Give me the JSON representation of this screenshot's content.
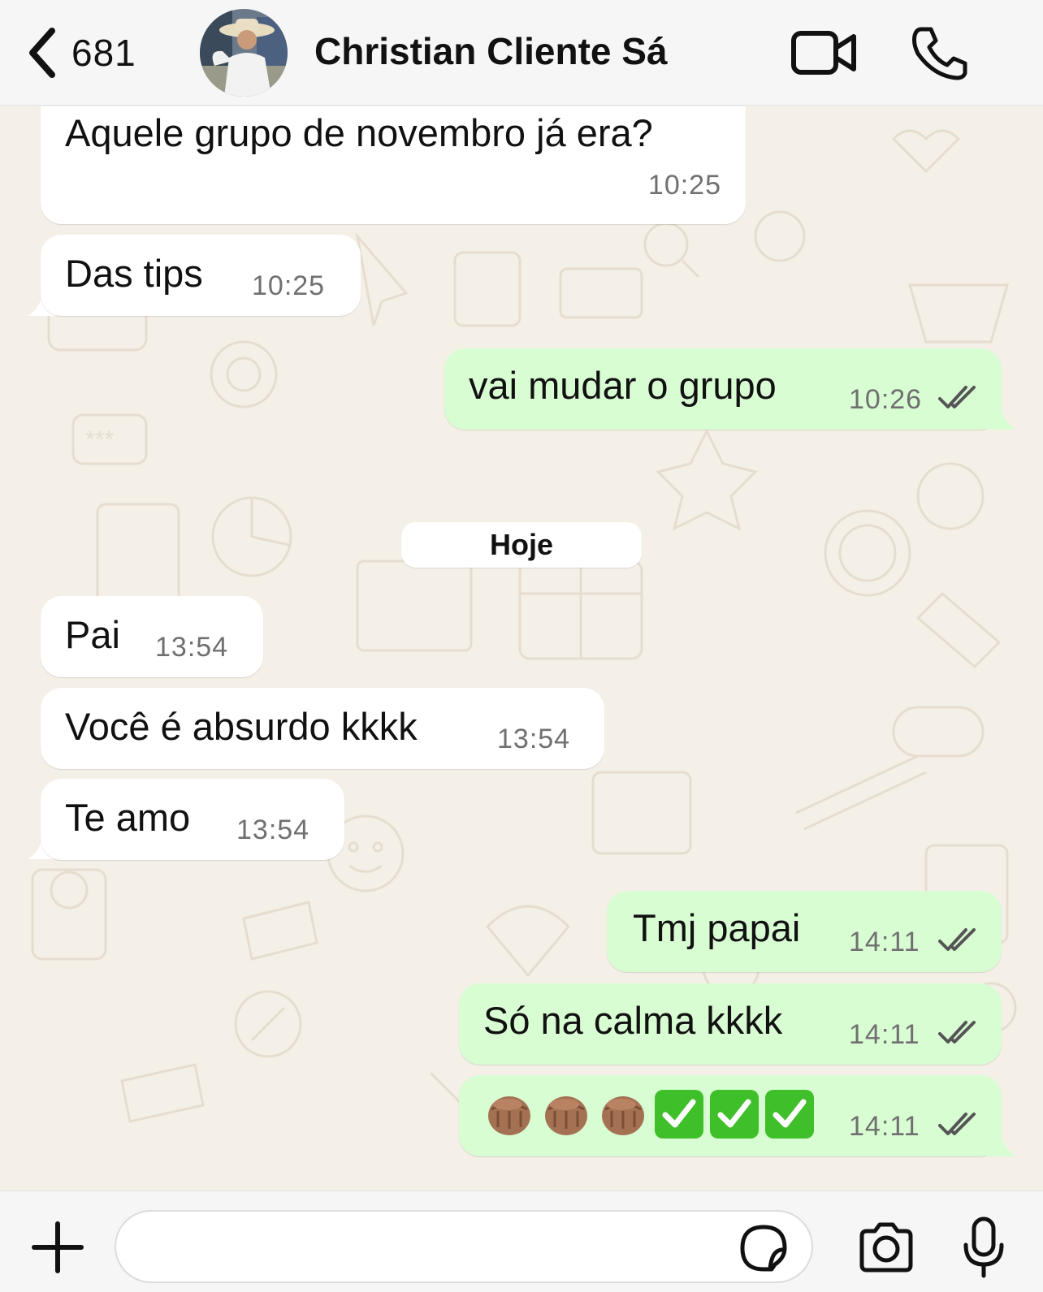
{
  "header": {
    "back_count": "681",
    "contact_name": "Christian Cliente Sá"
  },
  "messages": [
    {
      "direction": "in",
      "text": "Aquele grupo de novembro já era?",
      "time": "10:25"
    },
    {
      "direction": "in",
      "text": "Das tips",
      "time": "10:25"
    },
    {
      "direction": "out",
      "text": "vai mudar o grupo",
      "time": "10:26",
      "status": "read"
    },
    {
      "direction": "in",
      "text": "Pai",
      "time": "13:54"
    },
    {
      "direction": "in",
      "text": "Você é absurdo kkkk",
      "time": "13:54"
    },
    {
      "direction": "in",
      "text": "Te amo",
      "time": "13:54"
    },
    {
      "direction": "out",
      "text": "Tmj papai",
      "time": "14:11",
      "status": "read"
    },
    {
      "direction": "out",
      "text": "Só na calma kkkk",
      "time": "14:11",
      "status": "read"
    },
    {
      "direction": "out",
      "emoji": [
        "oncoming-fist-medium-skin-tone",
        "oncoming-fist-medium-skin-tone",
        "oncoming-fist-medium-skin-tone",
        "check-mark-button",
        "check-mark-button",
        "check-mark-button"
      ],
      "time": "14:11",
      "status": "read"
    }
  ],
  "date_separator": "Hoje",
  "composer": {
    "placeholder": ""
  },
  "icons": {
    "back": "chevron-left-icon",
    "video": "video-camera-icon",
    "call": "phone-icon",
    "plus": "plus-icon",
    "sticker": "sticker-icon",
    "camera": "camera-icon",
    "mic": "microphone-icon",
    "read": "double-check-icon"
  },
  "colors": {
    "incoming_bubble": "#ffffff",
    "outgoing_bubble": "#d9fdd3",
    "chat_background": "#f4f0e8",
    "header_background": "#f6f6f6",
    "timestamp": "#707070"
  }
}
